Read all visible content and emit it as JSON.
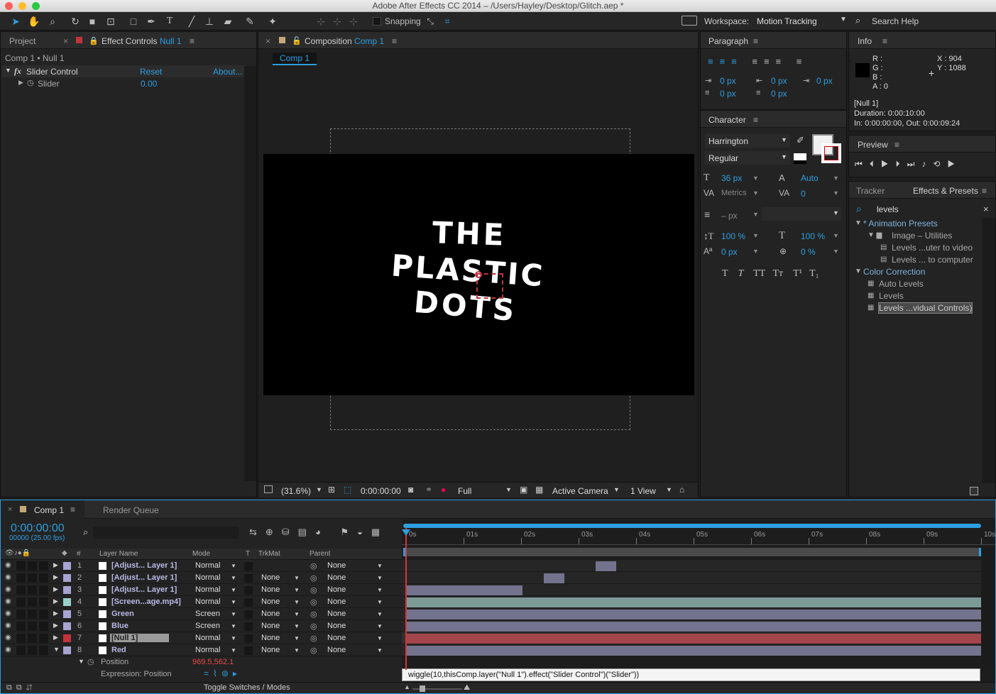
{
  "window": {
    "title": "Adobe After Effects CC 2014 – /Users/Hayley/Desktop/Glitch.aep *"
  },
  "toolbar": {
    "snapping": "Snapping",
    "workspace_label": "Workspace:",
    "workspace_value": "Motion Tracking",
    "search_help": "Search Help"
  },
  "project_tab": "Project",
  "effect_controls": {
    "tab": "Effect Controls",
    "layer": "Null 1",
    "breadcrumb": "Comp 1 • Null 1",
    "effect_name": "Slider Control",
    "reset": "Reset",
    "about": "About...",
    "prop_name": "Slider",
    "prop_value": "0.00"
  },
  "composition": {
    "tab": "Composition",
    "name": "Comp 1",
    "chip": "Comp 1",
    "text_lines": [
      "THE",
      "PLASTIC",
      "DOTS"
    ],
    "zoom": "(31.6%)",
    "timecode": "0:00:00:00",
    "resolution": "Full",
    "camera": "Active Camera",
    "views": "1 View"
  },
  "paragraph": {
    "title": "Paragraph",
    "indent_left": "0 px",
    "indent_right": "0 px",
    "indent_first": "0 px",
    "space_before": "0 px",
    "space_after": "0 px"
  },
  "character": {
    "title": "Character",
    "font": "Harrington",
    "style": "Regular",
    "size": "36 px",
    "leading": "Auto",
    "kerning": "Metrics",
    "tracking": "0",
    "stroke": "– px",
    "vscale": "100 %",
    "hscale": "100 %",
    "baseline": "0 px",
    "tsume": "0 %",
    "styles": [
      "T",
      "T",
      "TT",
      "Tт",
      "T¹",
      "T₁"
    ]
  },
  "info": {
    "title": "Info",
    "r": "R :",
    "g": "G :",
    "b": "B :",
    "a": "A : 0",
    "x": "X : 904",
    "y": "Y : 1088",
    "layer": "[Null 1]",
    "duration": "Duration: 0:00:10:00",
    "inout": "In: 0:00:00:00, Out: 0:00:09:24"
  },
  "preview": {
    "title": "Preview"
  },
  "effects": {
    "tab_tracker": "Tracker",
    "tab_effects": "Effects & Presets",
    "search": "levels",
    "items": [
      {
        "label": "* Animation Presets",
        "indent": 0,
        "type": "folder-open"
      },
      {
        "label": "Image – Utilities",
        "indent": 1,
        "type": "folder"
      },
      {
        "label": "Levels ...uter to video",
        "indent": 2,
        "type": "preset"
      },
      {
        "label": "Levels ... to computer",
        "indent": 2,
        "type": "preset"
      },
      {
        "label": "Color Correction",
        "indent": 0,
        "type": "folder-open"
      },
      {
        "label": "Auto Levels",
        "indent": 1,
        "type": "effect"
      },
      {
        "label": "Levels",
        "indent": 1,
        "type": "effect"
      },
      {
        "label": "Levels ...vidual Controls)",
        "indent": 1,
        "type": "effect",
        "selected": true
      }
    ]
  },
  "timeline": {
    "tab": "Comp 1",
    "render_queue": "Render Queue",
    "timecode": "0:00:00:00",
    "fps": "00000 (25.00 fps)",
    "columns": {
      "layer_name": "Layer Name",
      "mode": "Mode",
      "t": "T",
      "trkmat": "TrkMat",
      "parent": "Parent"
    },
    "ruler": [
      "0s",
      "01s",
      "02s",
      "03s",
      "04s",
      "05s",
      "06s",
      "07s",
      "08s",
      "09s",
      "10s"
    ],
    "layers": [
      {
        "num": "1",
        "name": "[Adjust... Layer 1]",
        "mode": "Normal",
        "trkmat": "",
        "parent": "None",
        "color": "#a5a4d3",
        "bar_start": 3.3,
        "bar_end": 3.65,
        "bar_color": "#74738e"
      },
      {
        "num": "2",
        "name": "[Adjust... Layer 1]",
        "mode": "Normal",
        "trkmat": "None",
        "parent": "None",
        "color": "#a5a4d3",
        "bar_start": 2.4,
        "bar_end": 2.75,
        "bar_color": "#74738e"
      },
      {
        "num": "3",
        "name": "[Adjust... Layer 1]",
        "mode": "Normal",
        "trkmat": "None",
        "parent": "None",
        "color": "#a5a4d3",
        "bar_start": 0.0,
        "bar_end": 2.03,
        "bar_color": "#74738e"
      },
      {
        "num": "4",
        "name": "[Screen...age.mp4]",
        "mode": "Normal",
        "trkmat": "None",
        "parent": "None",
        "color": "#9ad0c8",
        "bar_start": 0.0,
        "bar_end": 10.0,
        "bar_color": "#7d9a97"
      },
      {
        "num": "5",
        "name": "Green",
        "mode": "Screen",
        "trkmat": "None",
        "parent": "None",
        "color": "#a5a4d3",
        "bar_start": 0.0,
        "bar_end": 10.0,
        "bar_color": "#74738e"
      },
      {
        "num": "6",
        "name": "Blue",
        "mode": "Screen",
        "trkmat": "None",
        "parent": "None",
        "color": "#a5a4d3",
        "bar_start": 0.0,
        "bar_end": 10.0,
        "bar_color": "#74738e"
      },
      {
        "num": "7",
        "name": "[Null 1]",
        "mode": "Normal",
        "trkmat": "None",
        "parent": "None",
        "color": "#c1343c",
        "bar_start": 0.0,
        "bar_end": 10.0,
        "bar_color": "#a3454a",
        "selected": true
      },
      {
        "num": "8",
        "name": "Red",
        "mode": "Normal",
        "trkmat": "None",
        "parent": "None",
        "color": "#a5a4d3",
        "bar_start": 0.0,
        "bar_end": 10.0,
        "bar_color": "#74738e"
      }
    ],
    "position_label": "Position",
    "position_value": "969.5,562.1",
    "expression_label": "Expression: Position",
    "expression": "wiggle(10,thisComp.layer(\"Null 1\").effect(\"Slider Control\")(\"Slider\"))",
    "toggle": "Toggle Switches / Modes"
  }
}
